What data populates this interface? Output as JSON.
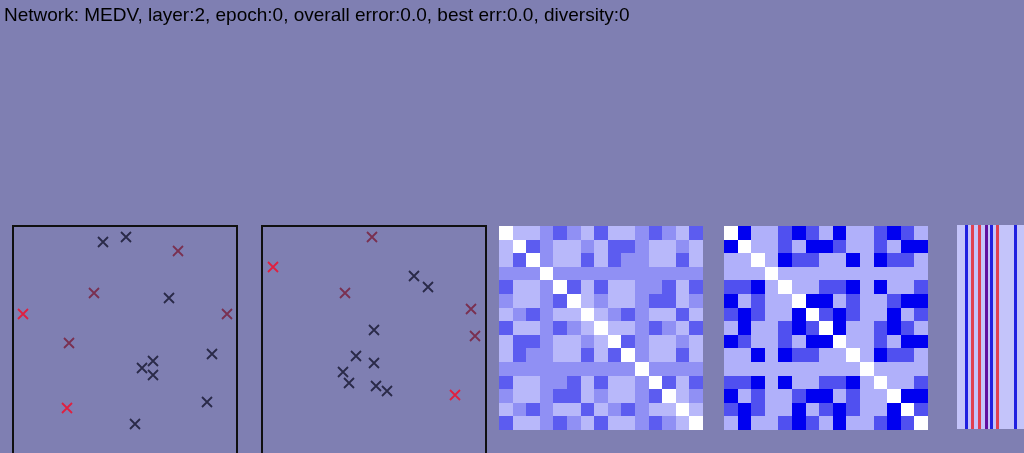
{
  "status_text": "Network: MEDV, layer:2, epoch:0, overall error:0.0, best err:0.0, diversity:0"
}
